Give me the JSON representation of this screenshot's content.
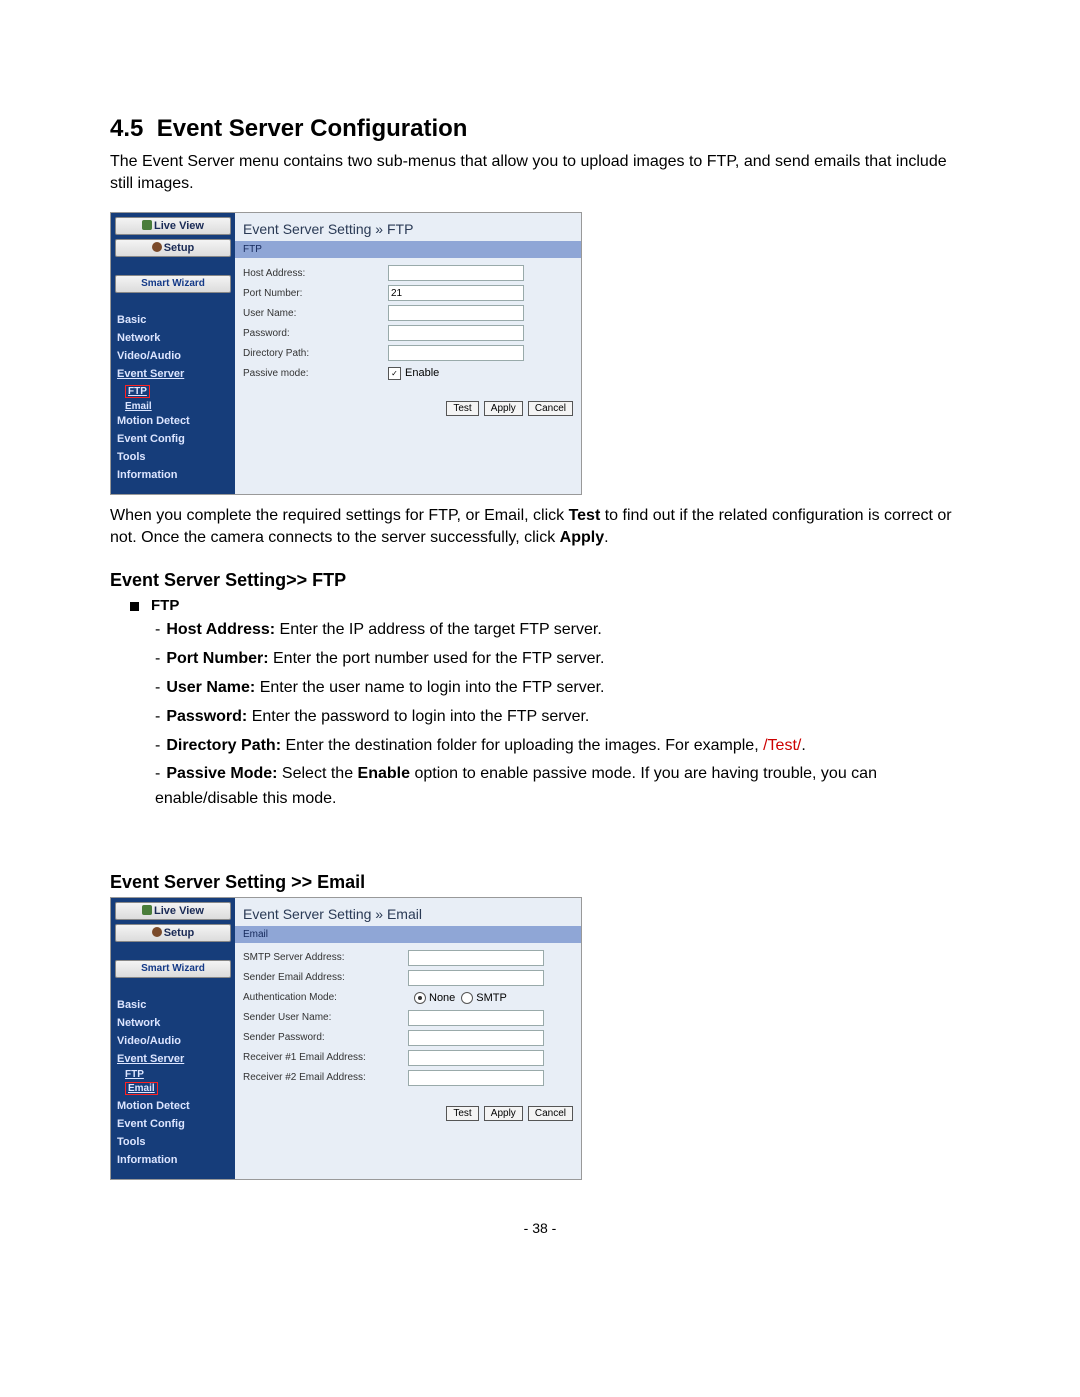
{
  "section_number": "4.5",
  "section_title": "Event Server Configuration",
  "intro": "The Event Server menu contains two sub-menus that allow you to upload images to FTP, and send emails that include still images.",
  "mid_text_pre": "When you complete the required settings for FTP, or Email, click ",
  "mid_text_bold1": "Test",
  "mid_text_mid": " to find out if the related configuration is correct or not. Once the camera connects to the server successfully, click ",
  "mid_text_bold2": "Apply",
  "mid_text_post": ".",
  "sub1_heading": "Event Server Setting>> FTP",
  "ftp_bullet_label": "FTP",
  "ftp_items": [
    {
      "b": "Host Address:",
      "t": " Enter the IP address of the target FTP server."
    },
    {
      "b": "Port Number:",
      "t": " Enter the port number used for the FTP server."
    },
    {
      "b": "User Name:",
      "t": " Enter the user name to login into the FTP server."
    },
    {
      "b": "Password:",
      "t": " Enter the password to login into the FTP server."
    },
    {
      "b": "Directory Path:",
      "t": " Enter the destination folder for uploading the images. For example, ",
      "r": "/Test/",
      "t2": "."
    },
    {
      "b": "Passive Mode:",
      "t": " Select the ",
      "b2": "Enable",
      "t2": " option to enable passive mode.  If you are having trouble, you can enable/disable this mode."
    }
  ],
  "sub2_heading": "Event Server Setting >> Email",
  "shot_nav": {
    "live_view": "Live View",
    "setup": "Setup",
    "smart_wizard": "Smart Wizard",
    "links": [
      "Basic",
      "Network",
      "Video/Audio",
      "Event Server",
      "Motion Detect",
      "Event Config",
      "Tools",
      "Information"
    ],
    "sub_ftp": "FTP",
    "sub_email": "Email"
  },
  "shot1": {
    "crumb": "Event Server Setting » FTP",
    "tab": "FTP",
    "labels": {
      "host": "Host Address:",
      "port": "Port Number:",
      "user": "User Name:",
      "pass": "Password:",
      "dir": "Directory Path:",
      "passive": "Passive mode:"
    },
    "port_value": "21",
    "passive_enable": "Enable",
    "btn_test": "Test",
    "btn_apply": "Apply",
    "btn_cancel": "Cancel"
  },
  "shot2": {
    "crumb": "Event Server Setting » Email",
    "tab": "Email",
    "labels": {
      "smtp": "SMTP Server Address:",
      "sender": "Sender Email Address:",
      "auth": "Authentication Mode:",
      "suser": "Sender User Name:",
      "spass": "Sender Password:",
      "r1": "Receiver #1 Email Address:",
      "r2": "Receiver #2 Email Address:"
    },
    "auth_none": "None",
    "auth_smtp": "SMTP",
    "btn_test": "Test",
    "btn_apply": "Apply",
    "btn_cancel": "Cancel"
  },
  "page_number": "- 38 -"
}
